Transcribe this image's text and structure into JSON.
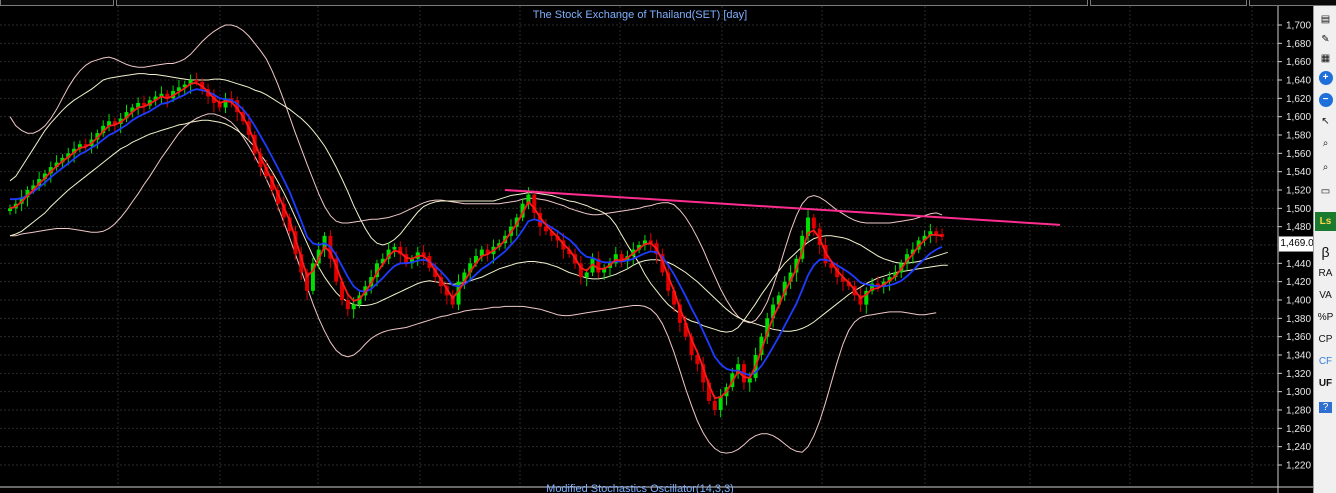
{
  "chart_title": "The Stock Exchange of Thailand(SET) [day]",
  "bottom_title": "Modified Stochastics Oscillator(14,3,3)",
  "last_price_label": "1,469.0",
  "colors": {
    "background": "#000000",
    "grid": "#2a2a2a",
    "title": "#7fb0ff",
    "up_candle": "#00e000",
    "down_candle": "#e00000",
    "ma_fast": "#ff1a1a",
    "ma_slow": "#1e3cff",
    "band_inner": "#f2f2cc",
    "band_outer": "#f0c8c8",
    "trendline": "#ff2d8f"
  },
  "sidebar": {
    "buttons": [
      {
        "name": "open-icon",
        "label": "",
        "glyph": "▤"
      },
      {
        "name": "edit-icon",
        "label": "",
        "glyph": "✎"
      },
      {
        "name": "properties-icon",
        "label": "",
        "glyph": "▦"
      },
      {
        "name": "zoom-in-icon",
        "label": "",
        "glyph": "+"
      },
      {
        "name": "zoom-out-icon",
        "label": "",
        "glyph": "−"
      },
      {
        "name": "cursor-icon",
        "label": "",
        "glyph": "↖"
      },
      {
        "name": "search-icon",
        "label": "",
        "glyph": "⌕"
      },
      {
        "name": "magnify-icon",
        "label": "",
        "glyph": "⌕"
      },
      {
        "name": "window-icon",
        "label": "",
        "glyph": "▭"
      },
      {
        "name": "ls-icon",
        "label": "Ls",
        "glyph": ""
      },
      {
        "name": "beta-button",
        "label": "β",
        "glyph": ""
      },
      {
        "name": "ra-button",
        "label": "RA",
        "glyph": ""
      },
      {
        "name": "va-button",
        "label": "VA",
        "glyph": ""
      },
      {
        "name": "percent-p-button",
        "label": "%P",
        "glyph": ""
      },
      {
        "name": "cp-button",
        "label": "CP",
        "glyph": ""
      },
      {
        "name": "cf-button",
        "label": "CF",
        "glyph": ""
      },
      {
        "name": "uf-button",
        "label": "UF",
        "glyph": ""
      },
      {
        "name": "help-icon",
        "label": "",
        "glyph": "?"
      }
    ]
  },
  "chart_data": {
    "type": "candlestick",
    "title": "The Stock Exchange of Thailand(SET) [day]",
    "ylim": [
      1220,
      1700
    ],
    "y_ticks": [
      "1,700",
      "1,680",
      "1,660",
      "1,640",
      "1,620",
      "1,600",
      "1,580",
      "1,560",
      "1,540",
      "1,520",
      "1,500",
      "1,480",
      "1,460",
      "1,440",
      "1,420",
      "1,400",
      "1,380",
      "1,360",
      "1,340",
      "1,320",
      "1,300",
      "1,280",
      "1,260",
      "1,240",
      "1,220"
    ],
    "grid": true,
    "close_series": [
      1500,
      1505,
      1512,
      1520,
      1525,
      1532,
      1538,
      1545,
      1550,
      1555,
      1560,
      1565,
      1570,
      1568,
      1575,
      1582,
      1590,
      1595,
      1592,
      1598,
      1605,
      1610,
      1615,
      1612,
      1618,
      1622,
      1625,
      1620,
      1628,
      1632,
      1635,
      1640,
      1638,
      1630,
      1622,
      1615,
      1610,
      1620,
      1618,
      1605,
      1595,
      1580,
      1560,
      1545,
      1535,
      1520,
      1505,
      1490,
      1475,
      1450,
      1430,
      1410,
      1440,
      1455,
      1470,
      1445,
      1420,
      1400,
      1390,
      1395,
      1405,
      1415,
      1425,
      1440,
      1445,
      1455,
      1458,
      1450,
      1440,
      1445,
      1452,
      1448,
      1435,
      1425,
      1415,
      1405,
      1395,
      1420,
      1430,
      1440,
      1448,
      1455,
      1450,
      1458,
      1462,
      1470,
      1480,
      1490,
      1505,
      1515,
      1495,
      1480,
      1475,
      1470,
      1465,
      1455,
      1450,
      1440,
      1425,
      1430,
      1445,
      1430,
      1435,
      1440,
      1450,
      1442,
      1448,
      1455,
      1460,
      1465,
      1462,
      1450,
      1430,
      1410,
      1395,
      1375,
      1360,
      1340,
      1330,
      1310,
      1290,
      1280,
      1295,
      1305,
      1320,
      1330,
      1310,
      1315,
      1340,
      1360,
      1380,
      1395,
      1405,
      1420,
      1430,
      1445,
      1470,
      1490,
      1478,
      1460,
      1440,
      1435,
      1425,
      1420,
      1415,
      1405,
      1395,
      1410,
      1418,
      1415,
      1420,
      1425,
      1430,
      1440,
      1450,
      1455,
      1465,
      1470,
      1475,
      1472,
      1469
    ],
    "ma_fast_series": [
      1500,
      1502,
      1507,
      1514,
      1520,
      1527,
      1533,
      1540,
      1546,
      1551,
      1556,
      1561,
      1566,
      1567,
      1571,
      1577,
      1584,
      1590,
      1591,
      1594,
      1599,
      1605,
      1610,
      1611,
      1614,
      1618,
      1622,
      1620,
      1623,
      1627,
      1631,
      1636,
      1637,
      1633,
      1627,
      1620,
      1615,
      1617,
      1616,
      1609,
      1600,
      1588,
      1572,
      1556,
      1543,
      1530,
      1516,
      1501,
      1487,
      1467,
      1446,
      1426,
      1432,
      1445,
      1458,
      1452,
      1437,
      1420,
      1406,
      1399,
      1401,
      1409,
      1418,
      1430,
      1439,
      1448,
      1454,
      1452,
      1446,
      1445,
      1448,
      1448,
      1442,
      1432,
      1422,
      1412,
      1402,
      1410,
      1420,
      1431,
      1440,
      1448,
      1450,
      1454,
      1459,
      1465,
      1474,
      1483,
      1495,
      1507,
      1500,
      1490,
      1482,
      1475,
      1469,
      1461,
      1455,
      1446,
      1435,
      1432,
      1439,
      1434,
      1434,
      1438,
      1444,
      1443,
      1446,
      1451,
      1456,
      1461,
      1462,
      1456,
      1443,
      1426,
      1410,
      1391,
      1375,
      1357,
      1343,
      1326,
      1307,
      1293,
      1294,
      1300,
      1311,
      1322,
      1316,
      1315,
      1328,
      1345,
      1364,
      1381,
      1394,
      1409,
      1421,
      1434,
      1453,
      1473,
      1476,
      1467,
      1452,
      1442,
      1432,
      1425,
      1419,
      1411,
      1402,
      1406,
      1412,
      1413,
      1417,
      1421,
      1426,
      1434,
      1443,
      1450,
      1459,
      1465,
      1471,
      1471,
      1470
    ],
    "ma_slow_series": [
      1510,
      1510,
      1511,
      1514,
      1518,
      1523,
      1528,
      1534,
      1539,
      1544,
      1549,
      1554,
      1559,
      1562,
      1566,
      1570,
      1575,
      1580,
      1583,
      1587,
      1591,
      1596,
      1600,
      1603,
      1606,
      1610,
      1614,
      1615,
      1618,
      1621,
      1624,
      1628,
      1630,
      1629,
      1627,
      1624,
      1620,
      1619,
      1618,
      1614,
      1608,
      1600,
      1590,
      1579,
      1568,
      1556,
      1544,
      1531,
      1518,
      1502,
      1486,
      1469,
      1462,
      1460,
      1462,
      1458,
      1449,
      1437,
      1425,
      1415,
      1410,
      1409,
      1412,
      1418,
      1424,
      1431,
      1437,
      1440,
      1440,
      1441,
      1443,
      1444,
      1442,
      1437,
      1431,
      1424,
      1416,
      1415,
      1417,
      1422,
      1428,
      1434,
      1438,
      1443,
      1448,
      1453,
      1460,
      1467,
      1476,
      1486,
      1488,
      1486,
      1483,
      1479,
      1475,
      1470,
      1466,
      1460,
      1452,
      1447,
      1446,
      1443,
      1441,
      1441,
      1442,
      1442,
      1443,
      1445,
      1448,
      1451,
      1453,
      1452,
      1447,
      1438,
      1428,
      1416,
      1404,
      1391,
      1379,
      1366,
      1352,
      1338,
      1330,
      1325,
      1323,
      1323,
      1320,
      1318,
      1321,
      1328,
      1338,
      1349,
      1360,
      1372,
      1384,
      1396,
      1411,
      1427,
      1438,
      1444,
      1444,
      1442,
      1438,
      1434,
      1430,
      1425,
      1419,
      1417,
      1416,
      1415,
      1415,
      1416,
      1418,
      1421,
      1426,
      1432,
      1439,
      1445,
      1451,
      1455,
      1458
    ],
    "band_inner_upper": [
      1530,
      1535,
      1545,
      1555,
      1565,
      1575,
      1585,
      1593,
      1600,
      1607,
      1613,
      1618,
      1622,
      1626,
      1630,
      1635,
      1640,
      1642,
      1643,
      1644,
      1645,
      1646,
      1647,
      1647,
      1646,
      1646,
      1645,
      1644,
      1643,
      1642,
      1641,
      1640,
      1640,
      1640,
      1640,
      1641,
      1641,
      1640,
      1638,
      1636,
      1634,
      1632,
      1629,
      1627,
      1624,
      1620,
      1616,
      1612,
      1608,
      1603,
      1598,
      1592,
      1585,
      1577,
      1568,
      1557,
      1545,
      1532,
      1518,
      1503,
      1490,
      1478,
      1468,
      1462,
      1460,
      1462,
      1466,
      1472,
      1480,
      1488,
      1496,
      1502,
      1505,
      1507,
      1508,
      1508,
      1508,
      1508,
      1508,
      1508,
      1508,
      1508,
      1508,
      1508,
      1510,
      1512,
      1514,
      1515,
      1516,
      1517,
      1517,
      1516,
      1515,
      1514,
      1512,
      1510,
      1508,
      1507,
      1505,
      1503,
      1500,
      1498,
      1495,
      1490,
      1482,
      1471,
      1460,
      1450,
      1440,
      1428,
      1418,
      1410,
      1402,
      1395,
      1390,
      1385,
      1380,
      1377,
      1375,
      1372,
      1370,
      1368,
      1366,
      1365,
      1366,
      1370,
      1378,
      1387,
      1396,
      1406,
      1415,
      1424,
      1432,
      1440,
      1446,
      1452,
      1458,
      1463,
      1467,
      1469,
      1470,
      1470,
      1469,
      1468,
      1466,
      1463,
      1460,
      1456,
      1452,
      1448,
      1445,
      1443,
      1441,
      1440,
      1440,
      1441,
      1442,
      1444,
      1446,
      1448,
      1450,
      1452
    ],
    "band_inner_lower": [
      1470,
      1472,
      1475,
      1480,
      1485,
      1490,
      1495,
      1502,
      1508,
      1514,
      1520,
      1525,
      1530,
      1535,
      1540,
      1545,
      1550,
      1555,
      1560,
      1565,
      1568,
      1572,
      1575,
      1578,
      1581,
      1583,
      1585,
      1587,
      1589,
      1591,
      1592,
      1594,
      1595,
      1596,
      1596,
      1595,
      1594,
      1592,
      1589,
      1585,
      1580,
      1574,
      1567,
      1559,
      1550,
      1540,
      1529,
      1517,
      1504,
      1490,
      1476,
      1462,
      1448,
      1436,
      1425,
      1416,
      1408,
      1402,
      1398,
      1395,
      1394,
      1394,
      1395,
      1397,
      1400,
      1403,
      1406,
      1409,
      1412,
      1415,
      1418,
      1420,
      1421,
      1420,
      1419,
      1418,
      1417,
      1418,
      1419,
      1421,
      1423,
      1425,
      1428,
      1431,
      1434,
      1436,
      1438,
      1440,
      1441,
      1442,
      1442,
      1441,
      1440,
      1438,
      1436,
      1433,
      1430,
      1428,
      1426,
      1424,
      1423,
      1423,
      1424,
      1426,
      1428,
      1431,
      1434,
      1438,
      1441,
      1443,
      1444,
      1444,
      1443,
      1441,
      1438,
      1434,
      1430,
      1425,
      1420,
      1414,
      1408,
      1402,
      1396,
      1390,
      1385,
      1381,
      1378,
      1376,
      1374,
      1372,
      1370,
      1368,
      1367,
      1366,
      1366,
      1367,
      1369,
      1372,
      1376,
      1381,
      1386,
      1391,
      1396,
      1401,
      1406,
      1410,
      1414,
      1418,
      1421,
      1424,
      1426,
      1428,
      1430,
      1431,
      1432,
      1433,
      1434,
      1435,
      1436,
      1437,
      1438,
      1438
    ],
    "band_outer_upper": [
      1600,
      1590,
      1585,
      1582,
      1582,
      1585,
      1590,
      1598,
      1608,
      1620,
      1632,
      1642,
      1650,
      1656,
      1660,
      1662,
      1664,
      1665,
      1663,
      1660,
      1657,
      1655,
      1654,
      1654,
      1655,
      1656,
      1657,
      1658,
      1658,
      1660,
      1663,
      1668,
      1675,
      1682,
      1688,
      1693,
      1697,
      1700,
      1700,
      1698,
      1694,
      1688,
      1680,
      1672,
      1663,
      1650,
      1635,
      1618,
      1600,
      1582,
      1565,
      1548,
      1532,
      1516,
      1502,
      1492,
      1486,
      1484,
      1484,
      1485,
      1486,
      1487,
      1488,
      1488,
      1489,
      1490,
      1492,
      1494,
      1497,
      1500,
      1503,
      1506,
      1508,
      1509,
      1509,
      1508,
      1507,
      1506,
      1505,
      1505,
      1505,
      1505,
      1505,
      1505,
      1505,
      1506,
      1507,
      1508,
      1510,
      1511,
      1511,
      1510,
      1509,
      1507,
      1505,
      1503,
      1500,
      1498,
      1496,
      1494,
      1493,
      1493,
      1494,
      1495,
      1496,
      1497,
      1498,
      1499,
      1500,
      1502,
      1503,
      1505,
      1506,
      1506,
      1504,
      1498,
      1490,
      1480,
      1468,
      1455,
      1440,
      1426,
      1412,
      1400,
      1390,
      1382,
      1377,
      1375,
      1378,
      1386,
      1398,
      1415,
      1434,
      1455,
      1475,
      1492,
      1505,
      1512,
      1514,
      1512,
      1508,
      1503,
      1498,
      1494,
      1490,
      1487,
      1485,
      1484,
      1484,
      1484,
      1484,
      1484,
      1485,
      1486,
      1487,
      1488,
      1490,
      1492,
      1494,
      1495,
      1493
    ],
    "band_outer_lower": [
      1470,
      1470,
      1472,
      1473,
      1474,
      1475,
      1476,
      1477,
      1478,
      1478,
      1478,
      1477,
      1476,
      1475,
      1474,
      1474,
      1475,
      1478,
      1483,
      1490,
      1498,
      1507,
      1516,
      1526,
      1535,
      1545,
      1555,
      1564,
      1573,
      1582,
      1589,
      1594,
      1598,
      1601,
      1603,
      1603,
      1601,
      1598,
      1594,
      1587,
      1578,
      1568,
      1557,
      1545,
      1532,
      1518,
      1502,
      1485,
      1468,
      1450,
      1432,
      1414,
      1396,
      1380,
      1366,
      1354,
      1345,
      1340,
      1338,
      1340,
      1345,
      1352,
      1358,
      1362,
      1365,
      1367,
      1368,
      1369,
      1370,
      1372,
      1374,
      1376,
      1378,
      1380,
      1382,
      1383,
      1385,
      1386,
      1388,
      1389,
      1390,
      1390,
      1391,
      1392,
      1392,
      1393,
      1393,
      1393,
      1393,
      1392,
      1391,
      1390,
      1388,
      1386,
      1384,
      1383,
      1383,
      1384,
      1385,
      1386,
      1387,
      1388,
      1389,
      1390,
      1391,
      1392,
      1393,
      1394,
      1394,
      1393,
      1390,
      1384,
      1374,
      1360,
      1343,
      1323,
      1303,
      1285,
      1268,
      1255,
      1245,
      1238,
      1234,
      1233,
      1234,
      1237,
      1242,
      1248,
      1252,
      1254,
      1254,
      1252,
      1248,
      1243,
      1238,
      1235,
      1234,
      1240,
      1252,
      1268,
      1288,
      1310,
      1332,
      1352,
      1367,
      1376,
      1381,
      1383,
      1384,
      1385,
      1386,
      1387,
      1387,
      1387,
      1386,
      1385,
      1384,
      1384,
      1385,
      1386
    ],
    "trendline": {
      "from": [
        161,
        1520
      ],
      "to": [
        336,
        1482
      ]
    }
  }
}
